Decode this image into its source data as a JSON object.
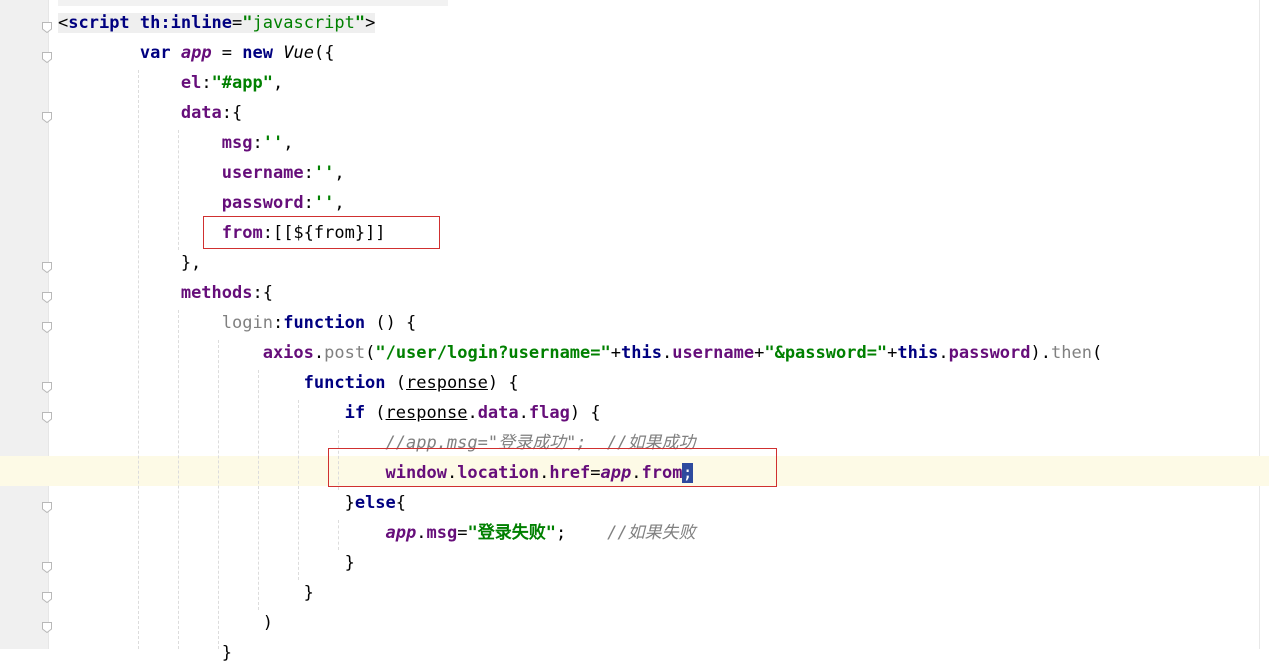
{
  "editor": {
    "lines": [
      {
        "segments": [
          {
            "t": "<",
            "c": "tagbg"
          },
          {
            "t": "script ",
            "c": "tag tagbg"
          },
          {
            "t": "th:inline",
            "c": "tag tagbg"
          },
          {
            "t": "=",
            "c": "tagbg"
          },
          {
            "t": "\"",
            "c": "str tagbg"
          },
          {
            "t": "javascript",
            "c": "str-plain tagbg"
          },
          {
            "t": "\"",
            "c": "str tagbg"
          },
          {
            "t": ">",
            "c": "tagbg"
          }
        ]
      },
      {
        "segments": [
          {
            "t": "        "
          },
          {
            "t": "var ",
            "c": "kw"
          },
          {
            "t": "app",
            "c": "varit"
          },
          {
            "t": " = "
          },
          {
            "t": "new ",
            "c": "kw"
          },
          {
            "t": "Vue",
            "c": "ital"
          },
          {
            "t": "({"
          }
        ]
      },
      {
        "segments": [
          {
            "t": "            "
          },
          {
            "t": "el",
            "c": "prop"
          },
          {
            "t": ":"
          },
          {
            "t": "\"#app\"",
            "c": "str"
          },
          {
            "t": ","
          }
        ]
      },
      {
        "segments": [
          {
            "t": "            "
          },
          {
            "t": "data",
            "c": "prop"
          },
          {
            "t": ":{"
          }
        ]
      },
      {
        "segments": [
          {
            "t": "                "
          },
          {
            "t": "msg",
            "c": "prop"
          },
          {
            "t": ":"
          },
          {
            "t": "''",
            "c": "str"
          },
          {
            "t": ","
          }
        ]
      },
      {
        "segments": [
          {
            "t": "                "
          },
          {
            "t": "username",
            "c": "prop"
          },
          {
            "t": ":"
          },
          {
            "t": "''",
            "c": "str"
          },
          {
            "t": ","
          }
        ]
      },
      {
        "segments": [
          {
            "t": "                "
          },
          {
            "t": "password",
            "c": "prop"
          },
          {
            "t": ":"
          },
          {
            "t": "''",
            "c": "str"
          },
          {
            "t": ","
          }
        ]
      },
      {
        "segments": [
          {
            "t": "                "
          },
          {
            "t": "from",
            "c": "prop"
          },
          {
            "t": ":[[${from}]]"
          }
        ]
      },
      {
        "segments": [
          {
            "t": "            },"
          }
        ]
      },
      {
        "segments": [
          {
            "t": "            "
          },
          {
            "t": "methods",
            "c": "prop"
          },
          {
            "t": ":{"
          }
        ]
      },
      {
        "segments": [
          {
            "t": "                "
          },
          {
            "t": "login",
            "c": "gray"
          },
          {
            "t": ":"
          },
          {
            "t": "function ",
            "c": "kw"
          },
          {
            "t": "() {"
          }
        ]
      },
      {
        "segments": [
          {
            "t": "                    "
          },
          {
            "t": "axios",
            "c": "prop"
          },
          {
            "t": "."
          },
          {
            "t": "post",
            "c": "gray"
          },
          {
            "t": "("
          },
          {
            "t": "\"/user/login?username=\"",
            "c": "str"
          },
          {
            "t": "+"
          },
          {
            "t": "this",
            "c": "kw"
          },
          {
            "t": "."
          },
          {
            "t": "username",
            "c": "prop"
          },
          {
            "t": "+"
          },
          {
            "t": "\"&password=\"",
            "c": "str"
          },
          {
            "t": "+"
          },
          {
            "t": "this",
            "c": "kw"
          },
          {
            "t": "."
          },
          {
            "t": "password",
            "c": "prop"
          },
          {
            "t": ")."
          },
          {
            "t": "then",
            "c": "gray"
          },
          {
            "t": "("
          }
        ]
      },
      {
        "segments": [
          {
            "t": "                        "
          },
          {
            "t": "function ",
            "c": "kw"
          },
          {
            "t": "("
          },
          {
            "t": "response",
            "c": "param"
          },
          {
            "t": ") {"
          }
        ]
      },
      {
        "segments": [
          {
            "t": "                            "
          },
          {
            "t": "if ",
            "c": "kw"
          },
          {
            "t": "("
          },
          {
            "t": "response",
            "c": "param"
          },
          {
            "t": "."
          },
          {
            "t": "data",
            "c": "prop"
          },
          {
            "t": "."
          },
          {
            "t": "flag",
            "c": "prop"
          },
          {
            "t": ") {"
          }
        ]
      },
      {
        "segments": [
          {
            "t": "                                "
          },
          {
            "t": "//app.msg=\"登录成功\";  //如果成功",
            "c": "cmt"
          }
        ]
      },
      {
        "segments": [
          {
            "t": "                                "
          },
          {
            "t": "window",
            "c": "prop"
          },
          {
            "t": "."
          },
          {
            "t": "location",
            "c": "prop"
          },
          {
            "t": "."
          },
          {
            "t": "href",
            "c": "prop"
          },
          {
            "t": "="
          },
          {
            "t": "app",
            "c": "varit"
          },
          {
            "t": "."
          },
          {
            "t": "from",
            "c": "prop"
          },
          {
            "t": ";",
            "c": "cursor"
          }
        ]
      },
      {
        "segments": [
          {
            "t": "                            "
          },
          {
            "t": "}"
          },
          {
            "t": "else",
            "c": "kw"
          },
          {
            "t": "{"
          }
        ]
      },
      {
        "segments": [
          {
            "t": "                                "
          },
          {
            "t": "app",
            "c": "varit"
          },
          {
            "t": "."
          },
          {
            "t": "msg",
            "c": "prop"
          },
          {
            "t": "="
          },
          {
            "t": "\"登录失败\"",
            "c": "str"
          },
          {
            "t": ";    "
          },
          {
            "t": "//如果失败",
            "c": "cmt"
          }
        ]
      },
      {
        "segments": [
          {
            "t": "                            }"
          }
        ]
      },
      {
        "segments": [
          {
            "t": "                        }"
          }
        ]
      },
      {
        "segments": [
          {
            "t": "                    )"
          }
        ]
      },
      {
        "segments": [
          {
            "t": "                }"
          }
        ]
      }
    ]
  }
}
